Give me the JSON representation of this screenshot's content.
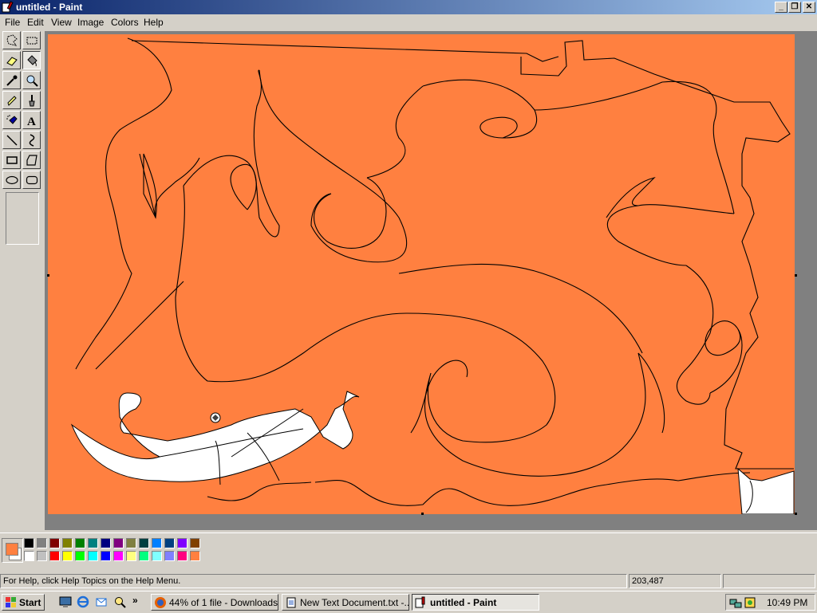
{
  "window": {
    "title": "untitled - Paint"
  },
  "menu": [
    "File",
    "Edit",
    "View",
    "Image",
    "Colors",
    "Help"
  ],
  "tools": [
    "free-form-select",
    "select",
    "eraser",
    "fill-with-color",
    "pick-color",
    "magnifier",
    "pencil",
    "brush",
    "airbrush",
    "text",
    "line",
    "curve",
    "rectangle",
    "polygon",
    "ellipse",
    "rounded-rectangle"
  ],
  "active_tool": "fill-with-color",
  "colors": {
    "foreground": "#ff8040",
    "background": "#ffffff",
    "canvas_fill": "#ff8040",
    "palette": [
      "#000000",
      "#808080",
      "#800000",
      "#808000",
      "#008000",
      "#008080",
      "#000080",
      "#800080",
      "#808040",
      "#004040",
      "#0080ff",
      "#004080",
      "#8000ff",
      "#804000",
      "#ffffff",
      "#c0c0c0",
      "#ff0000",
      "#ffff00",
      "#00ff00",
      "#00ffff",
      "#0000ff",
      "#ff00ff",
      "#ffff80",
      "#00ff80",
      "#80ffff",
      "#8080ff",
      "#ff0080",
      "#ff8040"
    ]
  },
  "status": {
    "help_text": "For Help, click Help Topics on the Help Menu.",
    "coordinates": "203,487"
  },
  "taskbar": {
    "start_label": "Start",
    "tasks": [
      "44% of 1 file - Downloads",
      "New Text Document.txt -...",
      "untitled - Paint"
    ],
    "clock": "10:49 PM"
  }
}
